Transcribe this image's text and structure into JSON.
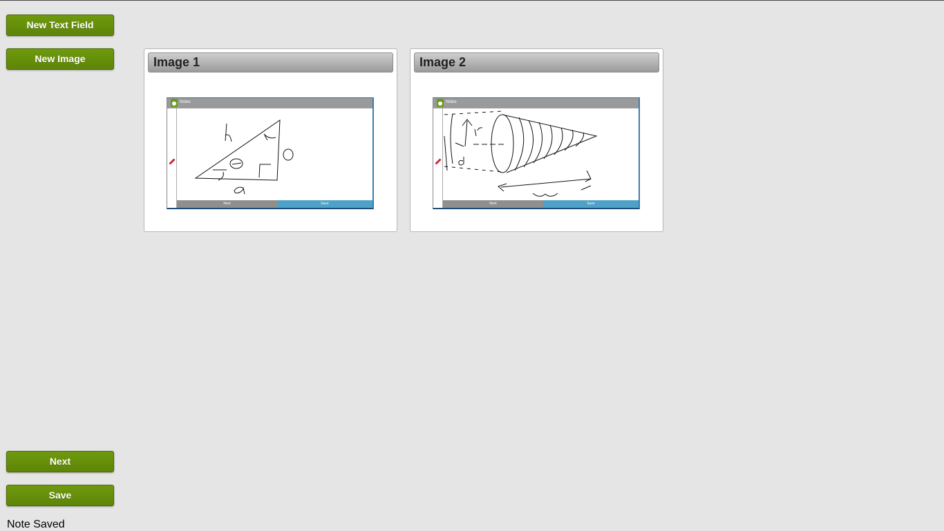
{
  "toolbar": {
    "new_text_field_label": "New Text Field",
    "new_image_label": "New Image",
    "next_label": "Next",
    "save_label": "Save"
  },
  "status": {
    "message": "Note Saved"
  },
  "images": [
    {
      "title": "Image 1",
      "thumbnail": {
        "app_title": "Notes",
        "next_label": "Next",
        "save_label": "Save",
        "drawing": "triangle-sketch"
      }
    },
    {
      "title": "Image 2",
      "thumbnail": {
        "app_title": "Notes",
        "next_label": "Next",
        "save_label": "Save",
        "drawing": "cone-sketch"
      }
    }
  ],
  "colors": {
    "button_green": "#6a900d",
    "thumb_save_blue": "#4ea1c8",
    "header_gray": "#9a9a9a"
  }
}
